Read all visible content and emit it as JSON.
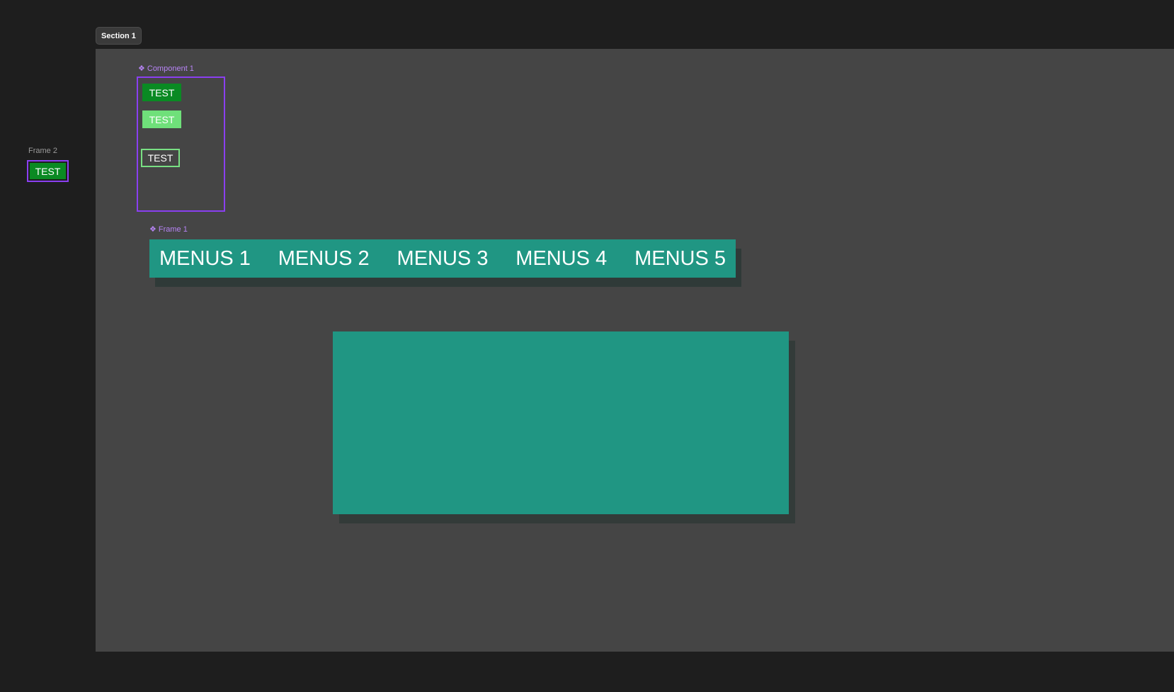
{
  "section": {
    "label": "Section 1"
  },
  "frame2": {
    "label": "Frame 2",
    "button_label": "TEST"
  },
  "component1": {
    "label": "Component 1",
    "glyph": "❖",
    "buttons": [
      {
        "label": "TEST",
        "variant": "filled"
      },
      {
        "label": "TEST",
        "variant": "light"
      },
      {
        "label": "TEST",
        "variant": "outline"
      }
    ]
  },
  "frame1": {
    "label": "Frame 1",
    "glyph": "❖",
    "menu_items": [
      "MENUS 1",
      "MENUS 2",
      "MENUS 3",
      "MENUS 4",
      "MENUS 5"
    ]
  },
  "colors": {
    "canvas_bg": "#1e1e1e",
    "section_bg": "#454545",
    "component_outline": "#8a3ff0",
    "teal": "#209683",
    "green_filled": "#0a8a23",
    "green_light": "#6fe07a",
    "green_outline": "#79e083"
  }
}
